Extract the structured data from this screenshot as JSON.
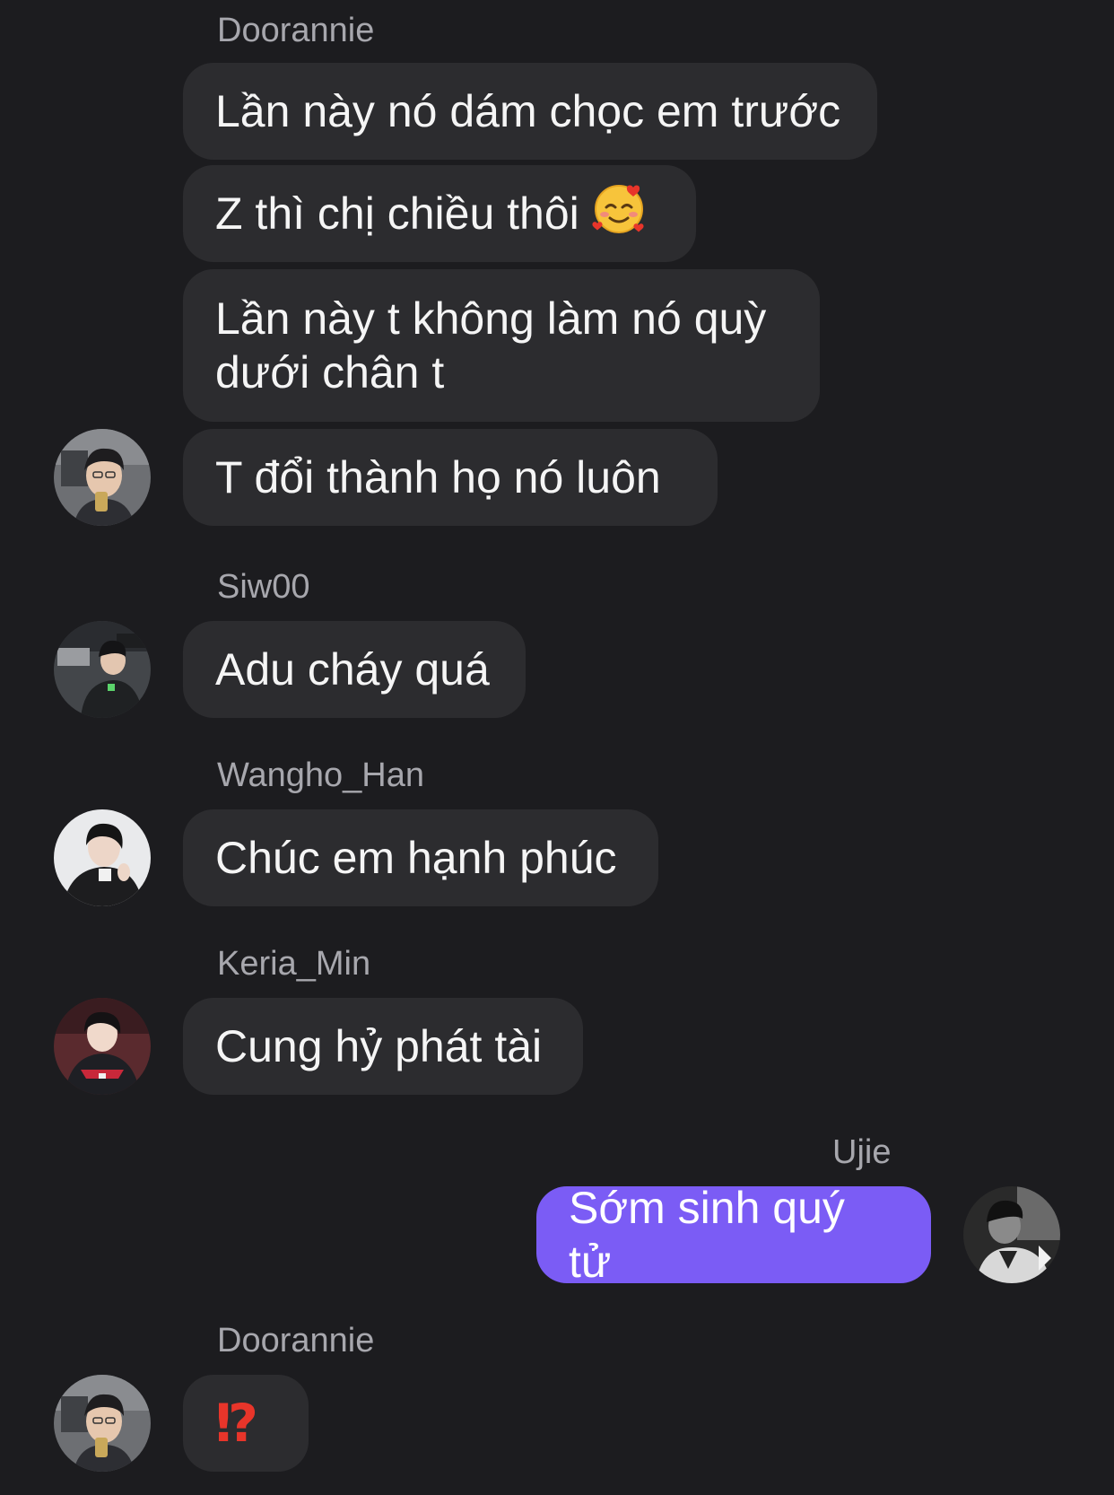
{
  "messages": [
    {
      "sender": "Doorannie",
      "text": "Lần này nó dám chọc em trước"
    },
    {
      "text": "Z thì chị chiều thôi",
      "emoji": "smiling-face-with-hearts"
    },
    {
      "text": "Lần này t không làm nó quỳ\ndưới chân t"
    },
    {
      "text": "T đổi thành họ nó luôn"
    },
    {
      "sender": "Siw00",
      "text": "Adu cháy quá"
    },
    {
      "sender": "Wangho_Han",
      "text": "Chúc em hạnh phúc"
    },
    {
      "sender": "Keria_Min",
      "text": "Cung hỷ phát tài"
    },
    {
      "sender": "Ujie",
      "text": "Sớm sinh quý tử",
      "own": true
    },
    {
      "sender": "Doorannie",
      "text": "⁉"
    }
  ],
  "colors": {
    "background": "#1c1c1f",
    "incoming_bubble": "#2c2c2f",
    "outgoing_bubble": "#7b5cf5",
    "sender_name": "#a7a7ad",
    "interrobang": "#e8352a"
  }
}
